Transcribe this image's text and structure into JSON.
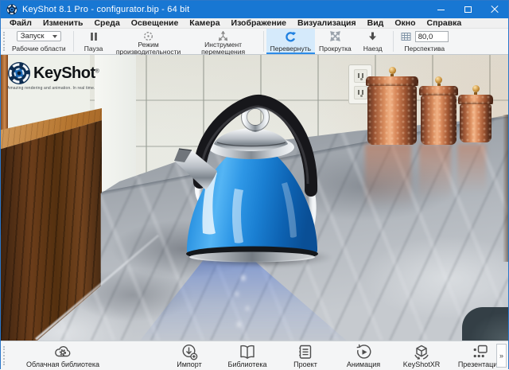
{
  "window": {
    "title": "KeyShot 8.1 Pro  - configurator.bip  - 64 bit"
  },
  "menu": {
    "items": [
      "Файл",
      "Изменить",
      "Среда",
      "Освещение",
      "Камера",
      "Изображение",
      "Визуализация",
      "Вид",
      "Окно",
      "Справка"
    ]
  },
  "toolbar": {
    "workspace_dropdown": {
      "value": "Запуск",
      "label": "Рабочие области"
    },
    "pause": {
      "label": "Пауза"
    },
    "performance": {
      "label": "Режим производительности"
    },
    "move_tool": {
      "label": "Инструмент перемещения"
    },
    "tumble": {
      "label": "Перевернуть",
      "active": true
    },
    "pan": {
      "label": "Прокрутка"
    },
    "dolly": {
      "label": "Наезд"
    },
    "perspective": {
      "label": "Перспектива",
      "value": "80,0"
    }
  },
  "viewport": {
    "watermark": {
      "brand": "KeyShot",
      "registered": "®",
      "tagline": "Amazing rendering and animation. In real time."
    }
  },
  "bottom_toolbar": {
    "items": [
      {
        "label": "Облачная библиотека",
        "icon": "cloud-library-icon"
      },
      {
        "label": "Импорт",
        "icon": "import-icon"
      },
      {
        "label": "Библиотека",
        "icon": "library-icon"
      },
      {
        "label": "Проект",
        "icon": "project-icon"
      },
      {
        "label": "Анимация",
        "icon": "animation-icon"
      },
      {
        "label": "KeyShotXR",
        "icon": "keyshotxr-icon"
      },
      {
        "label": "Презентация",
        "icon": "presentation-icon"
      }
    ],
    "overflow": "»"
  },
  "colors": {
    "titlebar": "#1877d3",
    "active_tool_bg": "#d5eafb",
    "active_tool_underline": "#2d8ce8",
    "kettle_blue": "#1f86d8",
    "copper": "#c07a50"
  }
}
